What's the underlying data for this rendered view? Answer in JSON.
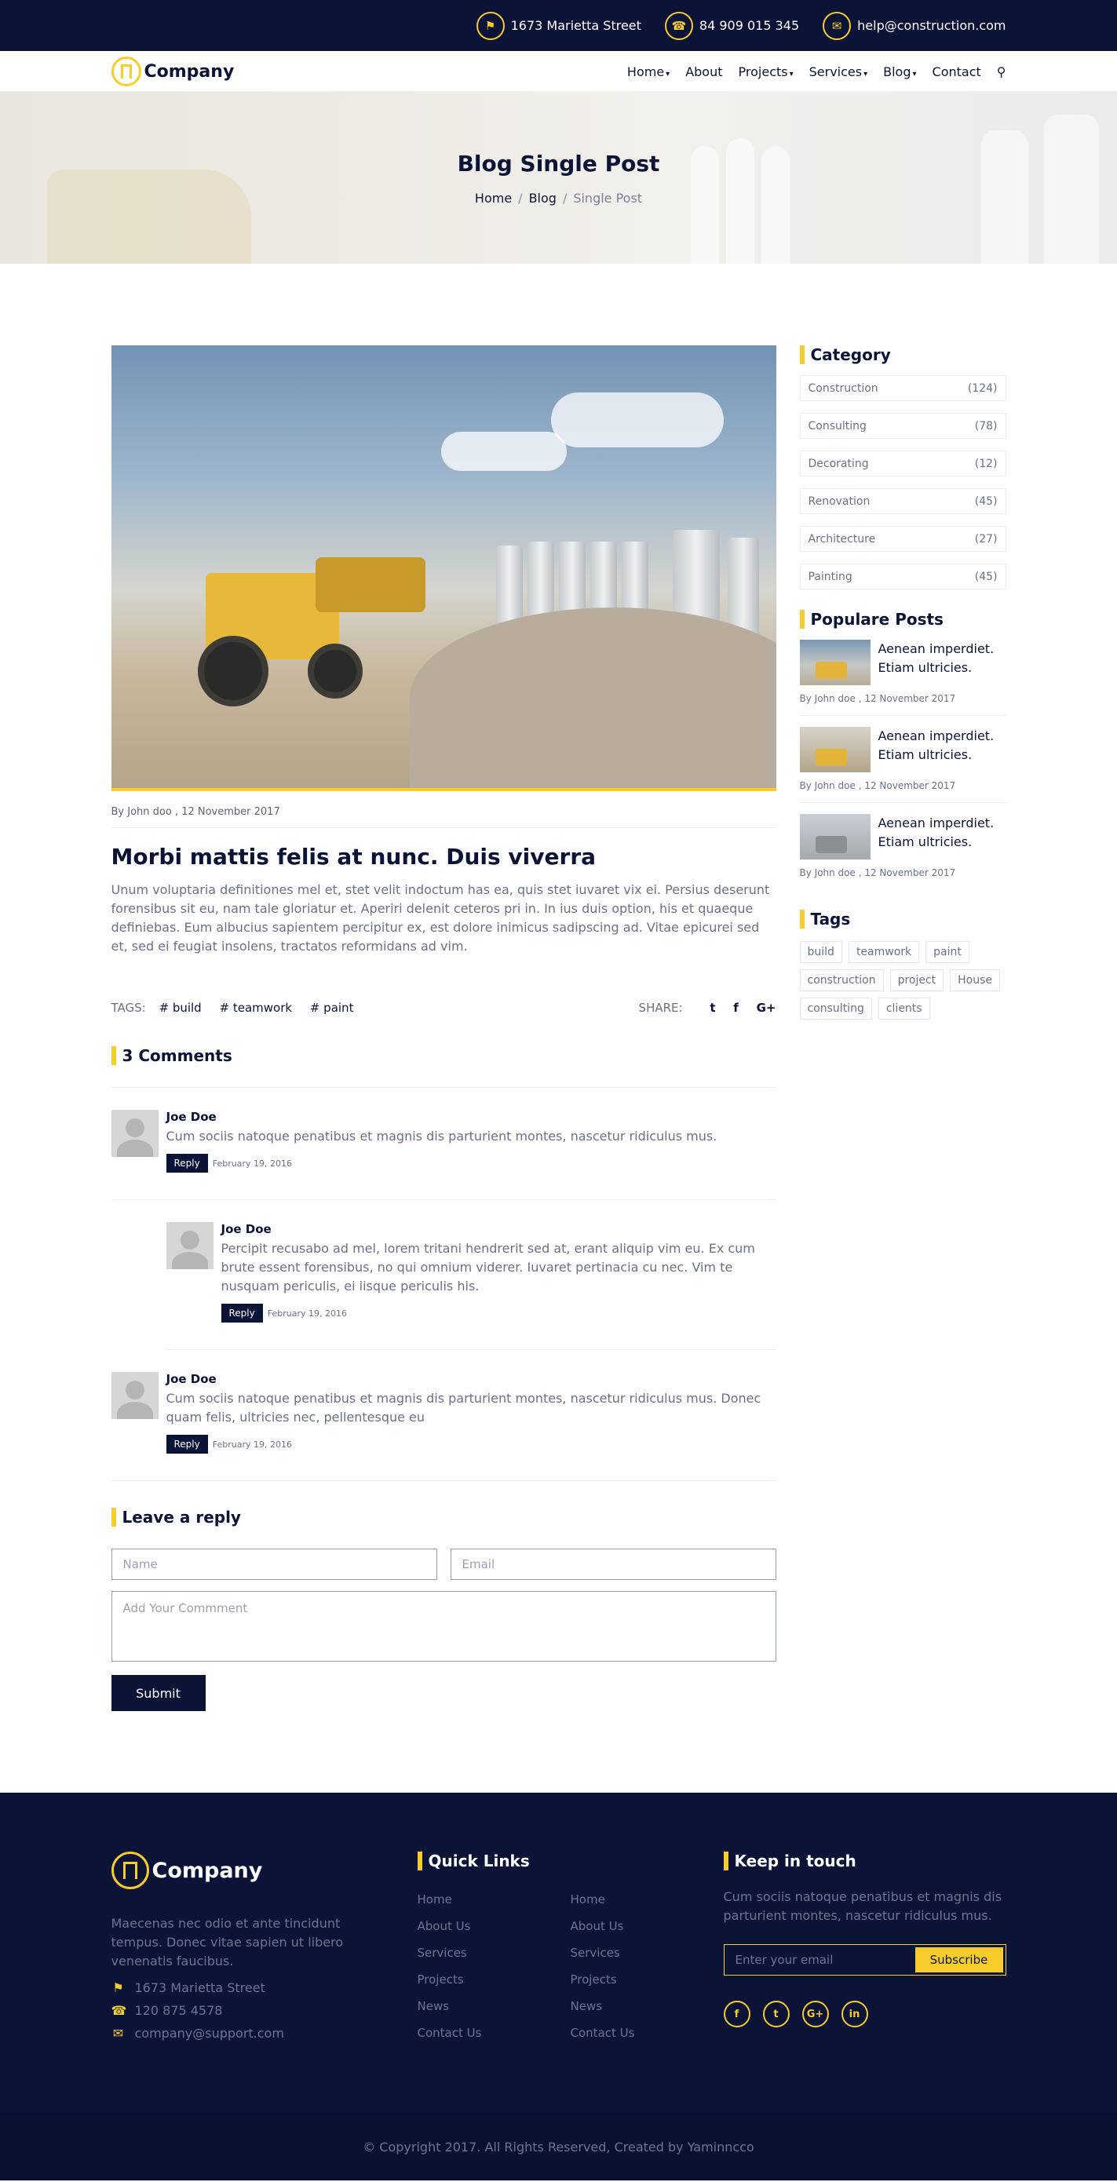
{
  "topbar": {
    "address": "1673 Marietta Street",
    "phone": "84 909 015 345",
    "email": "help@construction.com"
  },
  "nav": {
    "brand": "Company",
    "items": [
      {
        "label": "Home",
        "dropdown": true
      },
      {
        "label": "About",
        "dropdown": false
      },
      {
        "label": "Projects",
        "dropdown": true
      },
      {
        "label": "Services",
        "dropdown": true
      },
      {
        "label": "Blog",
        "dropdown": true
      },
      {
        "label": "Contact",
        "dropdown": false
      }
    ]
  },
  "hero": {
    "title": "Blog Single Post",
    "breadcrumb": [
      "Home",
      "Blog",
      "Single Post"
    ]
  },
  "post": {
    "meta": "By John doo , 12 November 2017",
    "title": "Morbi mattis felis at nunc. Duis viverra",
    "body": "Unum voluptaria definitiones mel et, stet velit indoctum has ea, quis stet iuvaret vix ei. Persius deserunt forensibus sit eu, nam tale gloriatur et. Aperiri delenit ceteros pri in. In ius duis option, his et quaeque definiebas. Eum albucius sapientem percipitur ex, est dolore inimicus sadipscing ad. Vitae epicurei sed et, sed ei feugiat insolens, tractatos reformidans ad vim.",
    "tags_label": "TAGS:",
    "tags": [
      "# build",
      "# teamwork",
      "# paint"
    ],
    "share_label": "SHARE:"
  },
  "comments": {
    "title": "3 Comments",
    "reply_label": "Reply",
    "items": [
      {
        "name": "Joe Doe",
        "text": "Cum sociis natoque penatibus et magnis dis parturient montes, nascetur ridiculus mus.",
        "date": "February 19, 2016"
      },
      {
        "name": "Joe Doe",
        "text": "Percipit recusabo ad mel, lorem tritani hendrerit sed at, erant aliquip vim eu. Ex cum brute essent forensibus, no qui omnium viderer. Iuvaret pertinacia cu nec. Vim te nusquam periculis, ei iisque periculis his.",
        "date": "February 19, 2016"
      },
      {
        "name": "Joe Doe",
        "text": "Cum sociis natoque penatibus et magnis dis parturient montes, nascetur ridiculus mus. Donec quam felis, ultricies nec, pellentesque eu",
        "date": "February 19, 2016"
      }
    ]
  },
  "reply_form": {
    "title": "Leave a reply",
    "name_placeholder": "Name",
    "email_placeholder": "Email",
    "comment_placeholder": "Add Your Commment",
    "submit_label": "Submit"
  },
  "sidebar": {
    "category_title": "Category",
    "categories": [
      {
        "name": "Construction",
        "count": "(124)"
      },
      {
        "name": "Consulting",
        "count": "(78)"
      },
      {
        "name": "Decorating",
        "count": "(12)"
      },
      {
        "name": "Renovation",
        "count": "(45)"
      },
      {
        "name": "Architecture",
        "count": "(27)"
      },
      {
        "name": "Painting",
        "count": "(45)"
      }
    ],
    "popular_title": "Populare Posts",
    "popular": [
      {
        "title": "Aenean imperdiet. Etiam ultricies.",
        "meta": "By John doe , 12 November 2017"
      },
      {
        "title": "Aenean imperdiet. Etiam ultricies.",
        "meta": "By John doe , 12 November 2017"
      },
      {
        "title": "Aenean imperdiet. Etiam ultricies.",
        "meta": "By John doe , 12 November 2017"
      }
    ],
    "tags_title": "Tags",
    "tags": [
      "build",
      "teamwork",
      "paint",
      "construction",
      "project",
      "House",
      "consulting",
      "clients"
    ]
  },
  "footer": {
    "brand": "Company",
    "about": "Maecenas nec odio et ante tincidunt tempus. Donec vitae sapien ut libero venenatis faucibus.",
    "address": "1673 Marietta Street",
    "phone": "120 875 4578",
    "email": "company@support.com",
    "quick_links_title": "Quick Links",
    "links_col1": [
      "Home",
      "About Us",
      "Services",
      "Projects",
      "News",
      "Contact Us"
    ],
    "links_col2": [
      "Home",
      "About Us",
      "Services",
      "Projects",
      "News",
      "Contact Us"
    ],
    "keep_title": "Keep in touch",
    "keep_text": "Cum sociis natoque penatibus et magnis dis parturient montes, nascetur ridiculus mus.",
    "email_placeholder": "Enter your email",
    "subscribe_label": "Subscribe",
    "socials": [
      "f",
      "t",
      "G+",
      "in"
    ],
    "copyright": "© Copyright 2017. All Rights Reserved, Created by Yaminncco"
  },
  "colors": {
    "navy": "#0b1437",
    "accent": "#f7cc2b"
  }
}
